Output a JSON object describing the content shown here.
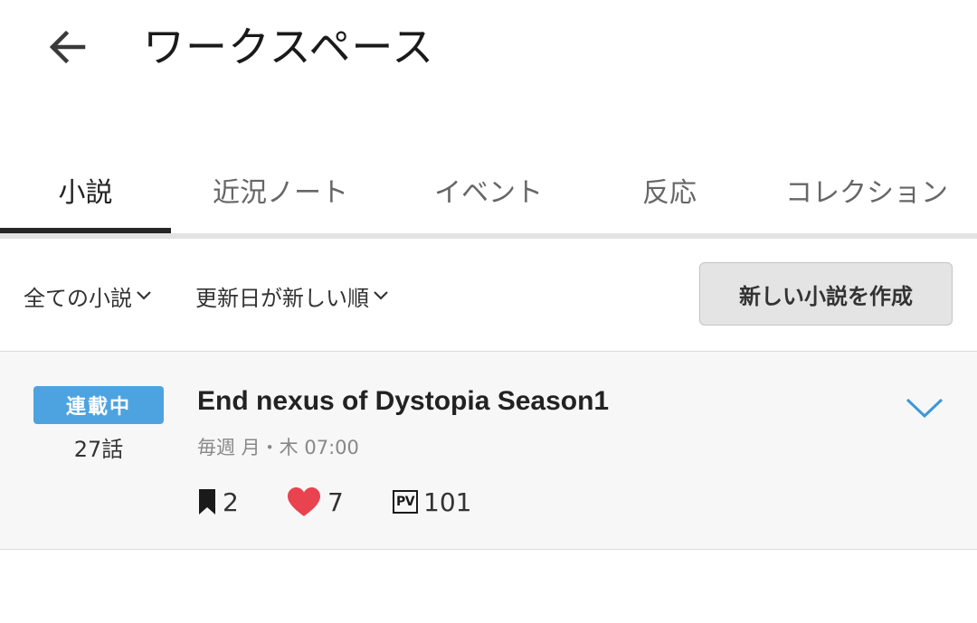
{
  "header": {
    "back_icon": "arrow-left-icon",
    "title": "ワークスペース"
  },
  "tabs": [
    {
      "label": "小説",
      "active": true
    },
    {
      "label": "近況ノート",
      "active": false
    },
    {
      "label": "イベント",
      "active": false
    },
    {
      "label": "反応",
      "active": false
    },
    {
      "label": "コレクション",
      "active": false
    }
  ],
  "filters": {
    "category": {
      "selected": "全ての小説",
      "icon": "chevron-down-icon"
    },
    "sort": {
      "selected": "更新日が新しい順",
      "icon": "chevron-down-icon"
    },
    "create_button_label": "新しい小説を作成"
  },
  "works": [
    {
      "status": "連載中",
      "episodes": "27話",
      "title": "End nexus of Dystopia Season1",
      "schedule": "毎週 月・木 07:00",
      "bookmarks": "2",
      "hearts": "7",
      "pv_label": "PV",
      "pv": "101",
      "expand_icon": "chevron-down-icon"
    }
  ],
  "colors": {
    "accent": "#4da3e0",
    "heart": "#e8434f",
    "active_tab_indicator": "#262626",
    "card_background": "#f7f7f7",
    "button_background": "#e4e4e4"
  }
}
